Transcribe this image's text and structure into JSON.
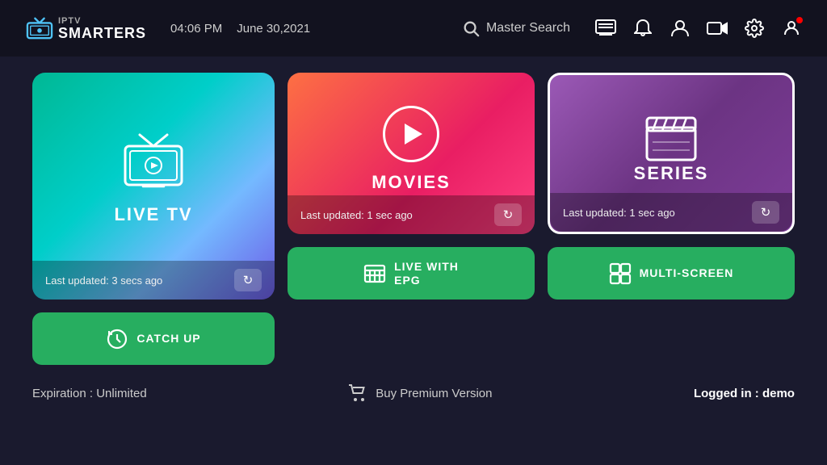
{
  "header": {
    "logo_iptv": "IPTV",
    "logo_smarters": "SMARTERS",
    "time": "04:06 PM",
    "date": "June 30,2021",
    "search_label": "Master Search",
    "icons": [
      "tv-guide-icon",
      "bell-icon",
      "user-icon",
      "record-icon",
      "settings-icon",
      "profile-badge-icon"
    ]
  },
  "cards": {
    "live_tv": {
      "label": "LIVE TV",
      "update_text": "Last updated: 3 secs ago"
    },
    "movies": {
      "label": "MOVIES",
      "update_text": "Last updated: 1 sec ago"
    },
    "series": {
      "label": "SERIES",
      "update_text": "Last updated: 1 sec ago"
    }
  },
  "buttons": {
    "live_epg": "LIVE WITH\nEPG",
    "live_epg_line1": "LIVE WITH",
    "live_epg_line2": "EPG",
    "multi_screen": "MULTI-SCREEN",
    "catch_up": "CATCH UP"
  },
  "footer": {
    "expiry": "Expiration : Unlimited",
    "buy": "Buy Premium Version",
    "logged_in_label": "Logged in :",
    "logged_in_user": "demo"
  }
}
